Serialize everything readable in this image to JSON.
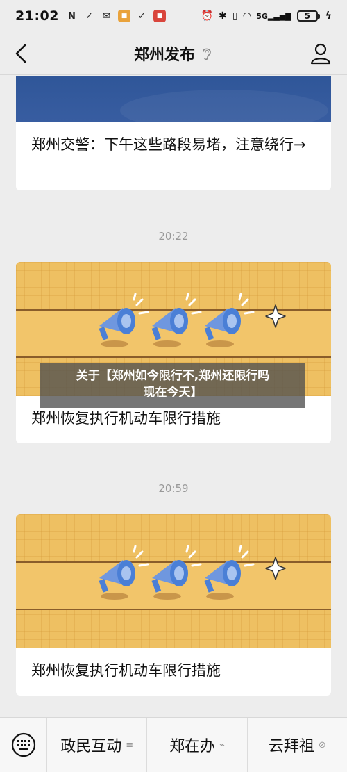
{
  "status_bar": {
    "time": "21:02",
    "network_label": "5G",
    "battery_level": "5"
  },
  "navbar": {
    "title": "郑州发布"
  },
  "messages": [
    {
      "title": "郑州交警：下午这些路段易堵，注意绕行→"
    },
    {
      "timestamp": "20:22",
      "title": "郑州恢复执行机动车限行措施"
    },
    {
      "timestamp": "20:59",
      "title": "郑州恢复执行机动车限行措施"
    }
  ],
  "overlay": {
    "line1": "关于【郑州如今限行不,郑州还限行吗",
    "line2": "现在今天】"
  },
  "bottom_menu": {
    "items": [
      {
        "label": "政民互动",
        "glyph": "≡"
      },
      {
        "label": "郑在办",
        "glyph": "⌁"
      },
      {
        "label": "云拜祖",
        "glyph": "⊘"
      }
    ]
  },
  "colors": {
    "background": "#ededed",
    "card_banner_blue": "#2e5597",
    "promo_yellow": "#eec062",
    "megaphone_blue": "#4a7fd6"
  }
}
